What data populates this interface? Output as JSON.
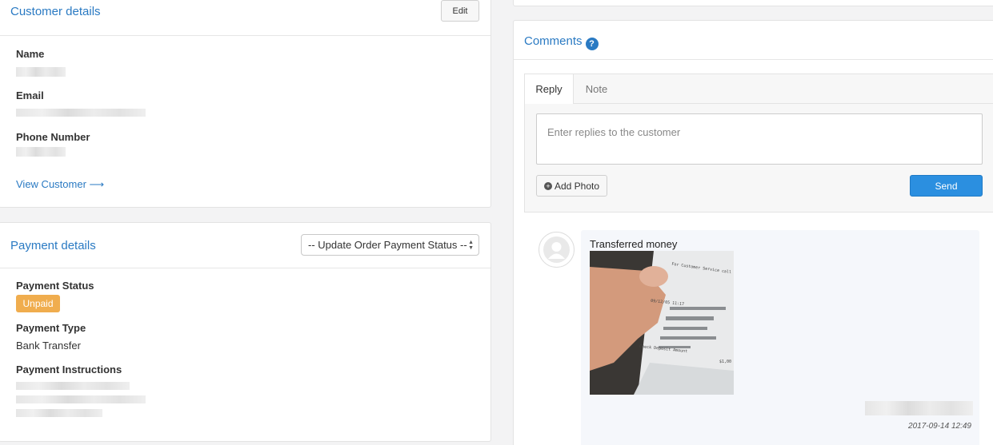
{
  "customer": {
    "title": "Customer details",
    "edit_label": "Edit",
    "name_label": "Name",
    "email_label": "Email",
    "phone_label": "Phone Number",
    "view_customer": "View Customer ⟶"
  },
  "payment": {
    "title": "Payment details",
    "status_select": "-- Update Order Payment Status --",
    "status_label": "Payment Status",
    "status_badge": "Unpaid",
    "type_label": "Payment Type",
    "type_value": "Bank Transfer",
    "instructions_label": "Payment Instructions"
  },
  "comments": {
    "title": "Comments",
    "help_glyph": "?",
    "tabs": [
      {
        "label": "Reply"
      },
      {
        "label": "Note"
      }
    ],
    "placeholder": "Enter replies to the customer",
    "add_photo": "Add Photo",
    "send": "Send",
    "message": {
      "text": "Transferred money",
      "timestamp": "2017-09-14 12:49",
      "image_caption": "For Customer Service call",
      "image_date": "09/12/05 11:17",
      "image_footer": "Check Deposit Amount",
      "image_amount": "$1,00"
    }
  },
  "colors": {
    "accent": "#2a7ac3",
    "badge": "#f0ad4e",
    "send": "#2b8fe0"
  }
}
